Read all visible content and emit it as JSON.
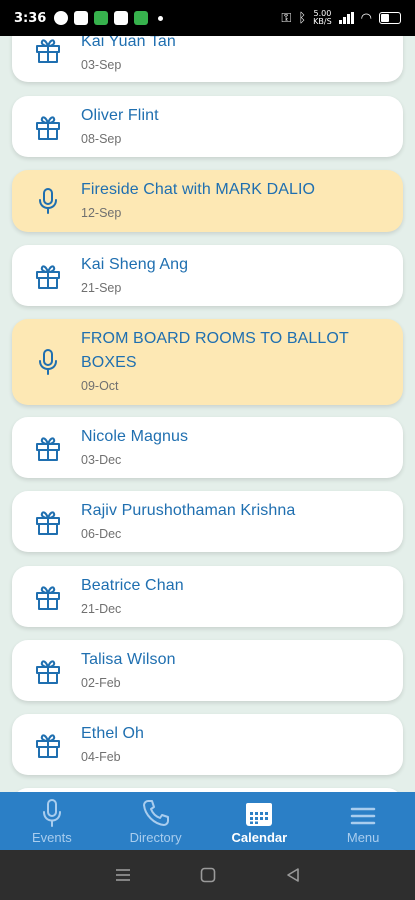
{
  "status_bar": {
    "time": "3:36",
    "network_speed_top": "5.00",
    "network_speed_bottom": "KB/S"
  },
  "events": [
    {
      "type": "birthday",
      "title": "Kai Yuan Tan",
      "date": "03-Sep",
      "icon": "gift-icon"
    },
    {
      "type": "birthday",
      "title": "Oliver Flint",
      "date": "08-Sep",
      "icon": "gift-icon"
    },
    {
      "type": "talk",
      "title": "Fireside Chat with MARK DALIO",
      "date": "12-Sep",
      "icon": "microphone-icon"
    },
    {
      "type": "birthday",
      "title": "Kai Sheng Ang",
      "date": "21-Sep",
      "icon": "gift-icon"
    },
    {
      "type": "talk",
      "title": "FROM BOARD ROOMS TO BALLOT BOXES",
      "date": "09-Oct",
      "icon": "microphone-icon"
    },
    {
      "type": "birthday",
      "title": "Nicole Magnus",
      "date": "03-Dec",
      "icon": "gift-icon"
    },
    {
      "type": "birthday",
      "title": "Rajiv Purushothaman Krishna",
      "date": "06-Dec",
      "icon": "gift-icon"
    },
    {
      "type": "birthday",
      "title": "Beatrice Chan",
      "date": "21-Dec",
      "icon": "gift-icon"
    },
    {
      "type": "birthday",
      "title": "Talisa Wilson",
      "date": "02-Feb",
      "icon": "gift-icon"
    },
    {
      "type": "birthday",
      "title": "Ethel Oh",
      "date": "04-Feb",
      "icon": "gift-icon"
    }
  ],
  "bottom_nav": {
    "items": [
      {
        "label": "Events",
        "icon": "microphone-icon",
        "active": false
      },
      {
        "label": "Directory",
        "icon": "phone-icon",
        "active": false
      },
      {
        "label": "Calendar",
        "icon": "calendar-icon",
        "active": true
      },
      {
        "label": "Menu",
        "icon": "hamburger-menu-icon",
        "active": false
      }
    ]
  },
  "colors": {
    "background": "#e4efea",
    "card": "#ffffff",
    "talk_card": "#fde8b4",
    "accent": "#1f6fb0",
    "nav_bar": "#2b7fc6"
  }
}
